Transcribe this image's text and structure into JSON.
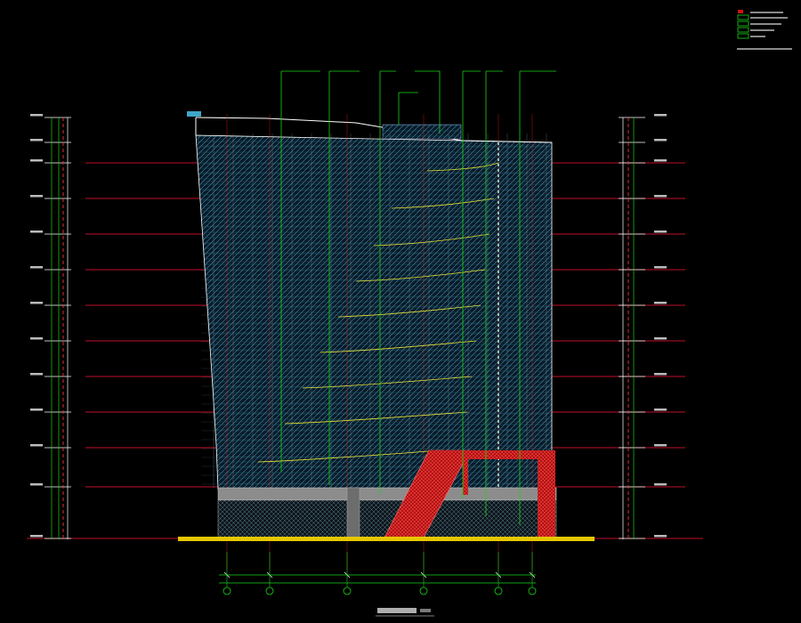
{
  "drawing": {
    "title": "",
    "scale": "",
    "colors": {
      "background": "#000000",
      "floor_line": "#c0102a",
      "leader": "#19d619",
      "grid_axis": "#e02020",
      "curtain_wall": "#2a6f8f",
      "glazing_hatch": "#3fa6c8",
      "ramp": "#c81414",
      "ground": "#e6c800",
      "podium": "#9a9a9a",
      "level_text": "#ffffff",
      "dashed_red": "#e03030",
      "yellow_curve": "#e8e030"
    }
  },
  "legend": {
    "rows": [
      "",
      "",
      "",
      "",
      "",
      "",
      ""
    ]
  },
  "level_marks": {
    "left": [
      "",
      "",
      "",
      "",
      "",
      "",
      "",
      "",
      "",
      "",
      "",
      "",
      ""
    ],
    "right": [
      "",
      "",
      "",
      "",
      "",
      "",
      "",
      "",
      "",
      "",
      "",
      "",
      ""
    ]
  },
  "callouts": [
    "",
    "",
    "",
    "",
    "",
    "",
    ""
  ],
  "axes": {
    "labels": [
      "",
      "",
      "",
      "",
      "",
      "",
      ""
    ],
    "dimensions": [
      "",
      "",
      "",
      "",
      "",
      "",
      ""
    ],
    "overall": ""
  }
}
